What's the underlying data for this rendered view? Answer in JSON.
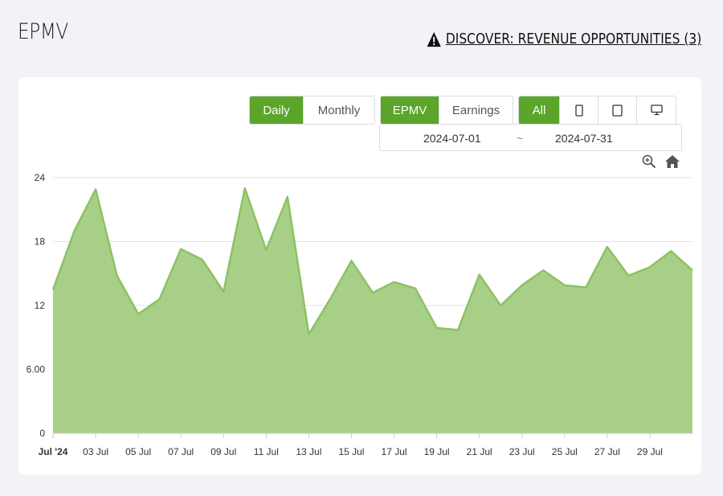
{
  "header": {
    "title": "EPMV",
    "discover_label": "DISCOVER: REVENUE OPPORTUNITIES (3)"
  },
  "controls": {
    "period": {
      "daily": "Daily",
      "monthly": "Monthly",
      "selected": "Daily"
    },
    "metric": {
      "epmv": "EPMV",
      "earnings": "Earnings",
      "selected": "EPMV"
    },
    "device": {
      "all": "All",
      "items": [
        "phone-icon",
        "tablet-icon",
        "desktop-icon"
      ],
      "selected": "All"
    },
    "date_range": {
      "start": "2024-07-01",
      "separator": "~",
      "end": "2024-07-31"
    },
    "tools": [
      "zoom-in-icon",
      "home-icon"
    ]
  },
  "colors": {
    "accent": "#5ba52b",
    "area_fill": "#a8cf87",
    "area_line": "#8cc263"
  },
  "chart_data": {
    "type": "area",
    "title": "",
    "xlabel": "",
    "ylabel": "",
    "ylim": [
      0,
      24
    ],
    "y_ticks": [
      "0",
      "6.00",
      "12",
      "18",
      "24"
    ],
    "x_ticks": [
      "Jul '24",
      "03 Jul",
      "05 Jul",
      "07 Jul",
      "09 Jul",
      "11 Jul",
      "13 Jul",
      "15 Jul",
      "17 Jul",
      "19 Jul",
      "21 Jul",
      "23 Jul",
      "25 Jul",
      "27 Jul",
      "29 Jul"
    ],
    "grid": true,
    "legend": "none",
    "x": [
      "2024-07-01",
      "2024-07-02",
      "2024-07-03",
      "2024-07-04",
      "2024-07-05",
      "2024-07-06",
      "2024-07-07",
      "2024-07-08",
      "2024-07-09",
      "2024-07-10",
      "2024-07-11",
      "2024-07-12",
      "2024-07-13",
      "2024-07-14",
      "2024-07-15",
      "2024-07-16",
      "2024-07-17",
      "2024-07-18",
      "2024-07-19",
      "2024-07-20",
      "2024-07-21",
      "2024-07-22",
      "2024-07-23",
      "2024-07-24",
      "2024-07-25",
      "2024-07-26",
      "2024-07-27",
      "2024-07-28",
      "2024-07-29",
      "2024-07-30",
      "2024-07-31"
    ],
    "series": [
      {
        "values": [
          13.5,
          19.0,
          22.9,
          14.8,
          11.2,
          12.6,
          17.3,
          16.3,
          13.3,
          23.0,
          17.2,
          22.2,
          9.3,
          12.6,
          16.2,
          13.2,
          14.2,
          13.6,
          9.9,
          9.7,
          14.9,
          12.0,
          13.9,
          15.3,
          13.9,
          13.7,
          17.5,
          14.8,
          15.6,
          17.1,
          15.3
        ]
      }
    ]
  }
}
